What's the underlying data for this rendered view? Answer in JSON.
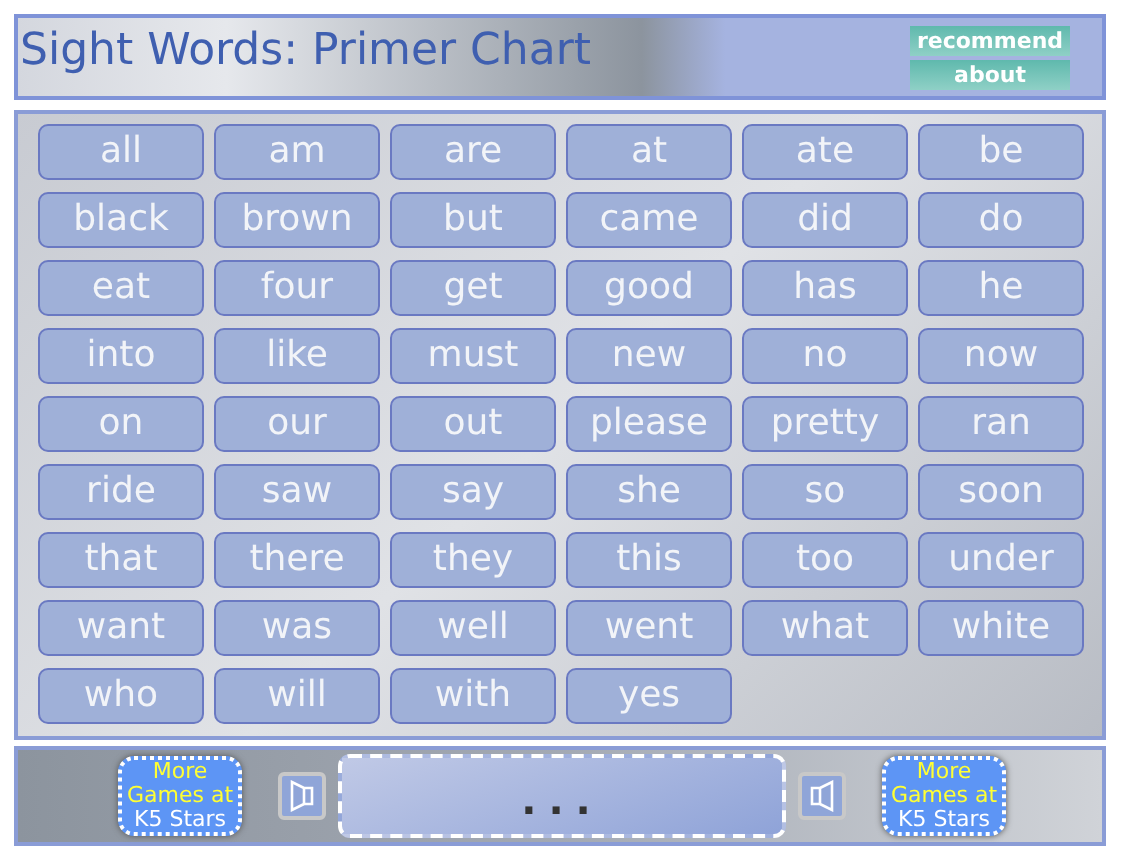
{
  "header": {
    "title": "Sight Words: Primer Chart",
    "buttons": [
      "recommend",
      "about"
    ]
  },
  "words": [
    "all",
    "am",
    "are",
    "at",
    "ate",
    "be",
    "black",
    "brown",
    "but",
    "came",
    "did",
    "do",
    "eat",
    "four",
    "get",
    "good",
    "has",
    "he",
    "into",
    "like",
    "must",
    "new",
    "no",
    "now",
    "on",
    "our",
    "out",
    "please",
    "pretty",
    "ran",
    "ride",
    "saw",
    "say",
    "she",
    "so",
    "soon",
    "that",
    "there",
    "they",
    "this",
    "too",
    "under",
    "want",
    "was",
    "well",
    "went",
    "what",
    "white",
    "who",
    "will",
    "with",
    "yes"
  ],
  "footer": {
    "promo_left": {
      "line_1": "More",
      "line_2": "Games at",
      "line_3": "K5 Stars"
    },
    "display": "...",
    "promo_right": {
      "line_1": "More",
      "line_2": "Games at",
      "line_3": "K5 Stars"
    }
  }
}
